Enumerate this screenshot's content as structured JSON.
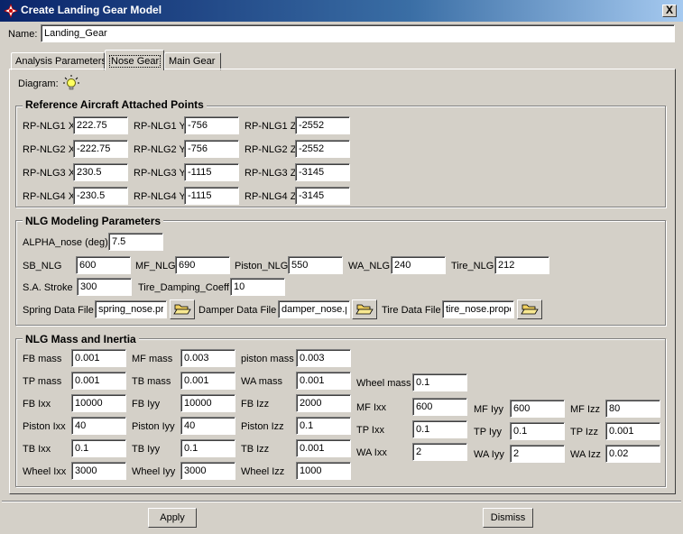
{
  "window": {
    "title": "Create Landing Gear Model",
    "close_label": "X"
  },
  "name": {
    "label": "Name:",
    "value": "Landing_Gear"
  },
  "tabs": [
    {
      "label": "Analysis Parameters"
    },
    {
      "label": "Nose Gear"
    },
    {
      "label": "Main Gear"
    }
  ],
  "diagram": {
    "label": "Diagram:"
  },
  "groups": {
    "attach": {
      "title": "Reference Aircraft Attached Points"
    },
    "model": {
      "title": "NLG Modeling Parameters"
    },
    "mass": {
      "title": "NLG Mass and Inertia"
    }
  },
  "attach_rows": [
    [
      {
        "label": "RP-NLG1 X",
        "value": "222.75"
      },
      {
        "label": "RP-NLG1 Y",
        "value": "-756"
      },
      {
        "label": "RP-NLG1 Z",
        "value": "-2552"
      }
    ],
    [
      {
        "label": "RP-NLG2 X",
        "value": "-222.75"
      },
      {
        "label": "RP-NLG2 Y",
        "value": "-756"
      },
      {
        "label": "RP-NLG2 Z",
        "value": "-2552"
      }
    ],
    [
      {
        "label": "RP-NLG3 X",
        "value": "230.5"
      },
      {
        "label": "RP-NLG3 Y",
        "value": "-1115"
      },
      {
        "label": "RP-NLG3 Z",
        "value": "-3145"
      }
    ],
    [
      {
        "label": "RP-NLG4 X",
        "value": "-230.5"
      },
      {
        "label": "RP-NLG4 Y",
        "value": "-1115"
      },
      {
        "label": "RP-NLG4 Z",
        "value": "-3145"
      }
    ]
  ],
  "model": {
    "alpha": {
      "label": "ALPHA_nose (deg)",
      "value": "7.5"
    },
    "row2": [
      {
        "label": "SB_NLG",
        "value": "600"
      },
      {
        "label": "MF_NLG",
        "value": "690"
      },
      {
        "label": "Piston_NLG",
        "value": "550"
      },
      {
        "label": "WA_NLG",
        "value": "240"
      },
      {
        "label": "Tire_NLG",
        "value": "212"
      }
    ],
    "row3": [
      {
        "label": "S.A. Stroke",
        "value": "300"
      },
      {
        "label": "Tire_Damping_Coeff",
        "value": "10"
      }
    ],
    "files": [
      {
        "label": "Spring Data File",
        "value": "spring_nose.prop"
      },
      {
        "label": "Damper Data File",
        "value": "damper_nose.prop"
      },
      {
        "label": "Tire Data File",
        "value": "tire_nose.prope"
      }
    ]
  },
  "mass_left": [
    [
      {
        "label": "FB mass",
        "value": "0.001"
      },
      {
        "label": "MF mass",
        "value": "0.003"
      },
      {
        "label": "piston mass",
        "value": "0.003"
      }
    ],
    [
      {
        "label": "TP mass",
        "value": "0.001"
      },
      {
        "label": "TB mass",
        "value": "0.001"
      },
      {
        "label": "WA mass",
        "value": "0.001"
      }
    ],
    [
      {
        "label": "FB Ixx",
        "value": "10000"
      },
      {
        "label": "FB Iyy",
        "value": "10000"
      },
      {
        "label": "FB Izz",
        "value": "2000"
      }
    ],
    [
      {
        "label": "Piston Ixx",
        "value": "40"
      },
      {
        "label": "Piston Iyy",
        "value": "40"
      },
      {
        "label": "Piston Izz",
        "value": "0.1"
      }
    ],
    [
      {
        "label": "TB Ixx",
        "value": "0.1"
      },
      {
        "label": "TB Iyy",
        "value": "0.1"
      },
      {
        "label": "TB Izz",
        "value": "0.001"
      }
    ],
    [
      {
        "label": "Wheel Ixx",
        "value": "3000"
      },
      {
        "label": "Wheel Iyy",
        "value": "3000"
      },
      {
        "label": "Wheel Izz",
        "value": "1000"
      }
    ]
  ],
  "mass_right": {
    "wheel_mass": {
      "label": "Wheel mass",
      "value": "0.1"
    },
    "rows": [
      [
        {
          "label": "MF Ixx",
          "value": "600"
        },
        {
          "label": "MF Iyy",
          "value": "600"
        },
        {
          "label": "MF Izz",
          "value": "80"
        }
      ],
      [
        {
          "label": "TP Ixx",
          "value": "0.1"
        },
        {
          "label": "TP Iyy",
          "value": "0.1"
        },
        {
          "label": "TP Izz",
          "value": "0.001"
        }
      ],
      [
        {
          "label": "WA Ixx",
          "value": "2"
        },
        {
          "label": "WA Iyy",
          "value": "2"
        },
        {
          "label": "WA Izz",
          "value": "0.02"
        }
      ]
    ]
  },
  "buttons": {
    "apply": "Apply",
    "dismiss": "Dismiss"
  },
  "icons": {
    "diagram": "lightbulb-icon",
    "browse": "folder-open-icon",
    "app": "abaqus-logo-icon"
  }
}
